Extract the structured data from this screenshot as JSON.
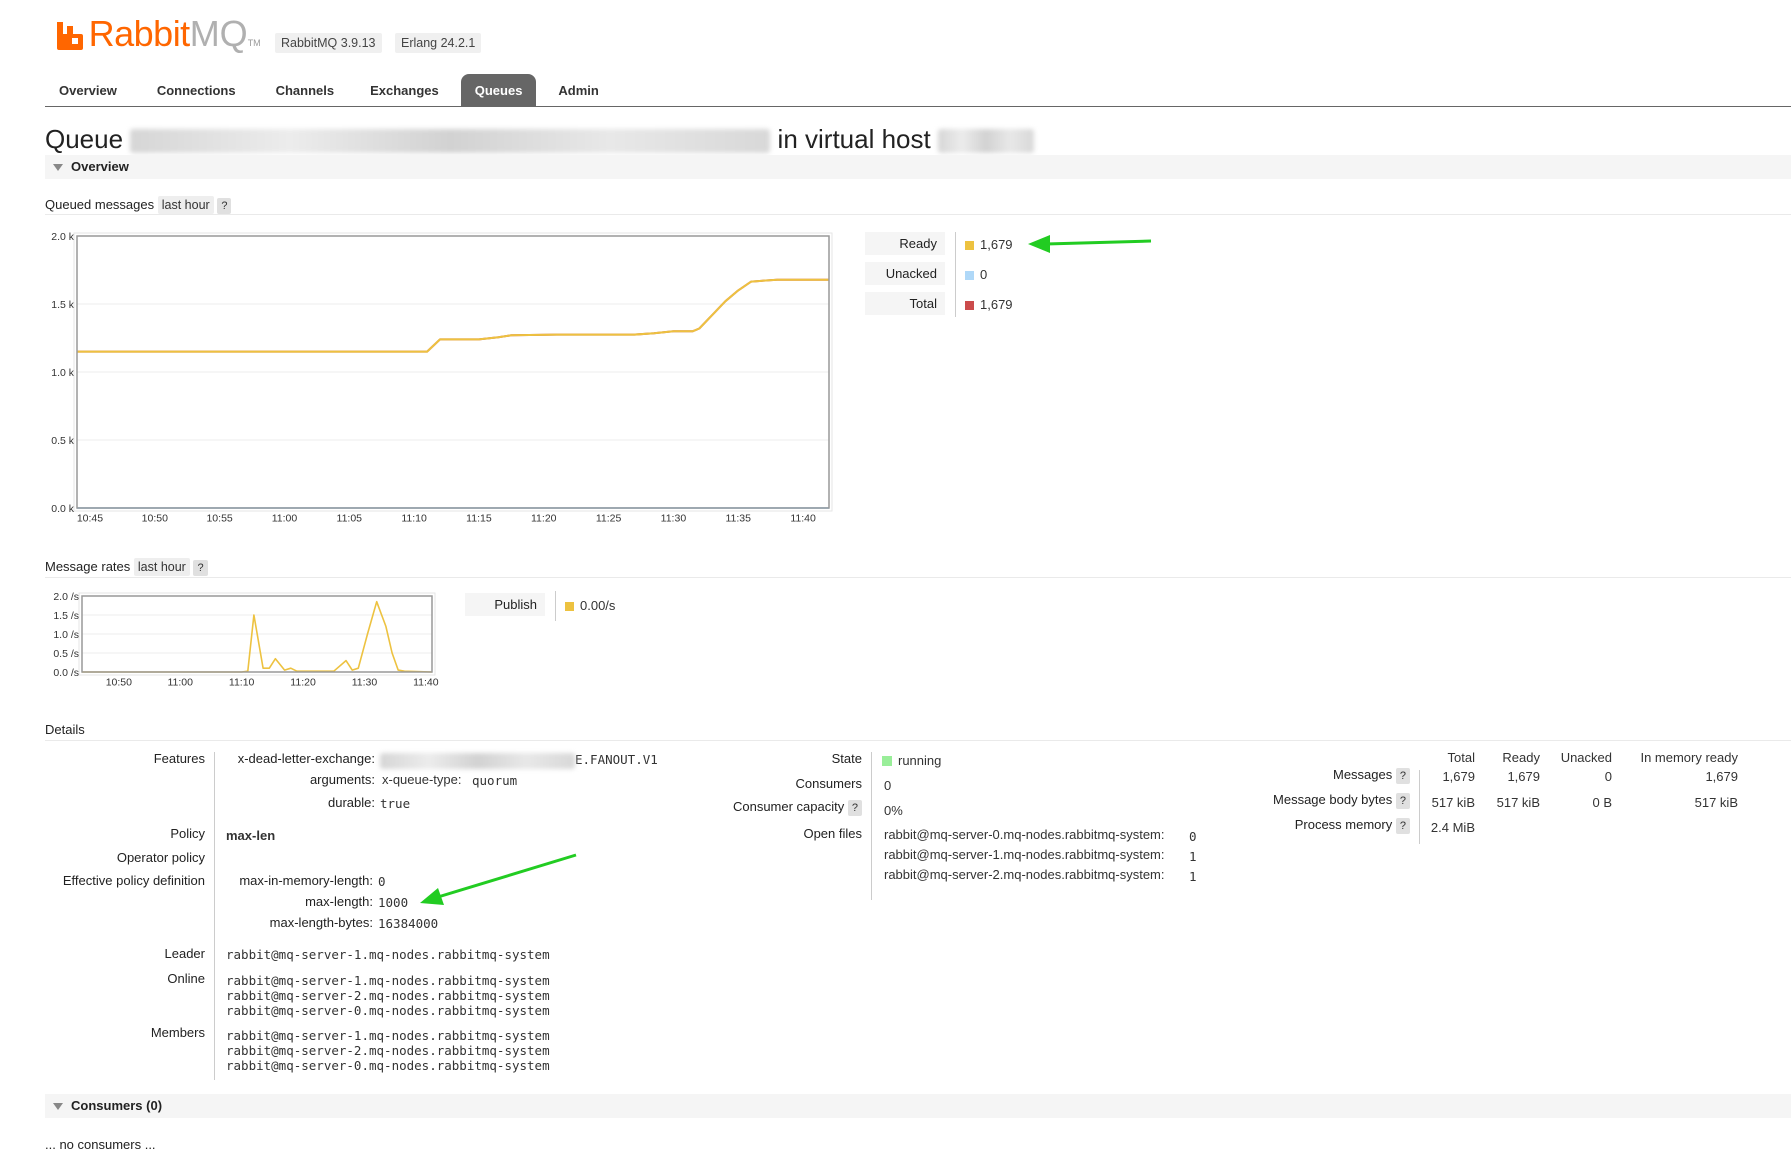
{
  "header": {
    "logo_rabbit": "Rabbit",
    "logo_mq": "MQ",
    "logo_tm": "TM",
    "rabbitmq_version": "RabbitMQ 3.9.13",
    "erlang_version": "Erlang 24.2.1"
  },
  "nav": {
    "tabs": [
      "Overview",
      "Connections",
      "Channels",
      "Exchanges",
      "Queues",
      "Admin"
    ],
    "active": "Queues"
  },
  "page": {
    "title_prefix": "Queue",
    "title_mid": "in virtual host"
  },
  "sections": {
    "overview": "Overview",
    "consumers": "Consumers (0)",
    "no_consumers": "... no consumers ..."
  },
  "queued_messages": {
    "label": "Queued messages",
    "range": "last hour",
    "help": "?",
    "legend": [
      {
        "label": "Ready",
        "value": "1,679",
        "color": "#edc240"
      },
      {
        "label": "Unacked",
        "value": "0",
        "color": "#afd8f8"
      },
      {
        "label": "Total",
        "value": "1,679",
        "color": "#cb4b4b"
      }
    ]
  },
  "message_rates": {
    "label": "Message rates",
    "range": "last hour",
    "help": "?",
    "legend": [
      {
        "label": "Publish",
        "value": "0.00/s",
        "color": "#edc240"
      }
    ]
  },
  "chart_data": [
    {
      "type": "line",
      "title": "Queued messages",
      "x_ticks": [
        "10:45",
        "10:50",
        "10:55",
        "11:00",
        "11:05",
        "11:10",
        "11:15",
        "11:20",
        "11:25",
        "11:30",
        "11:35",
        "11:40"
      ],
      "y_ticks": [
        "0.0 k",
        "0.5 k",
        "1.0 k",
        "1.5 k",
        "2.0 k"
      ],
      "xlim": [
        44.0,
        102.0
      ],
      "ylim": [
        0,
        2000
      ],
      "grid": true,
      "series": [
        {
          "name": "Total",
          "color": "#cb4b4b",
          "x": [
            44.0,
            71.0,
            72.0,
            75.0,
            76.5,
            77.5,
            81.0,
            87.0,
            88.5,
            90.0,
            91.5,
            92.0,
            93.0,
            94.0,
            95.0,
            96.0,
            98.0,
            102.0
          ],
          "y": [
            1150,
            1150,
            1240,
            1240,
            1255,
            1270,
            1275,
            1275,
            1285,
            1300,
            1300,
            1320,
            1420,
            1520,
            1600,
            1665,
            1679,
            1679
          ]
        },
        {
          "name": "Ready",
          "color": "#edc240",
          "x": [
            44.0,
            71.0,
            72.0,
            75.0,
            76.5,
            77.5,
            81.0,
            87.0,
            88.5,
            90.0,
            91.5,
            92.0,
            93.0,
            94.0,
            95.0,
            96.0,
            98.0,
            102.0
          ],
          "y": [
            1150,
            1150,
            1240,
            1240,
            1255,
            1270,
            1275,
            1275,
            1285,
            1300,
            1300,
            1320,
            1420,
            1520,
            1600,
            1665,
            1679,
            1679
          ]
        },
        {
          "name": "Unacked",
          "color": "#afd8f8",
          "x": [
            44.0,
            102.0
          ],
          "y": [
            0,
            0
          ]
        }
      ]
    },
    {
      "type": "line",
      "title": "Message rates",
      "x_ticks": [
        "10:50",
        "11:00",
        "11:10",
        "11:20",
        "11:30",
        "11:40"
      ],
      "y_ticks": [
        "0.0 /s",
        "0.5 /s",
        "1.0 /s",
        "1.5 /s",
        "2.0 /s"
      ],
      "xlim": [
        44.0,
        101.0
      ],
      "ylim": [
        0,
        2.0
      ],
      "grid": true,
      "series": [
        {
          "name": "Publish",
          "color": "#edc240",
          "x": [
            44.0,
            70.0,
            71.0,
            72.0,
            73.5,
            74.5,
            75.5,
            77.0,
            78.0,
            79.0,
            85.0,
            87.0,
            88.0,
            89.0,
            90.5,
            92.0,
            93.5,
            94.5,
            95.5,
            96.5,
            101.0
          ],
          "y": [
            0,
            0,
            0.02,
            1.5,
            0.1,
            0.1,
            0.35,
            0.05,
            0.1,
            0.02,
            0.02,
            0.3,
            0.05,
            0.1,
            1.0,
            1.85,
            1.2,
            0.5,
            0.05,
            0.02,
            0
          ]
        }
      ]
    }
  ],
  "details": {
    "label": "Details",
    "features": {
      "key": "Features",
      "dle_key": "x-dead-letter-exchange:",
      "dle_value_suffix": "E.FANOUT.V1",
      "arguments_key": "arguments:",
      "queue_type_key": "x-queue-type:",
      "queue_type_value": "quorum",
      "durable_key": "durable:",
      "durable_value": "true"
    },
    "policy": {
      "key": "Policy",
      "value": "max-len"
    },
    "operator_policy": {
      "key": "Operator policy",
      "value": ""
    },
    "effective_policy": {
      "key": "Effective policy definition",
      "items": [
        {
          "key": "max-in-memory-length:",
          "value": "0"
        },
        {
          "key": "max-length:",
          "value": "1000"
        },
        {
          "key": "max-length-bytes:",
          "value": "16384000"
        }
      ]
    },
    "leader": {
      "key": "Leader",
      "value": "rabbit@mq-server-1.mq-nodes.rabbitmq-system"
    },
    "online": {
      "key": "Online",
      "values": [
        "rabbit@mq-server-1.mq-nodes.rabbitmq-system",
        "rabbit@mq-server-2.mq-nodes.rabbitmq-system",
        "rabbit@mq-server-0.mq-nodes.rabbitmq-system"
      ]
    },
    "members": {
      "key": "Members",
      "values": [
        "rabbit@mq-server-1.mq-nodes.rabbitmq-system",
        "rabbit@mq-server-2.mq-nodes.rabbitmq-system",
        "rabbit@mq-server-0.mq-nodes.rabbitmq-system"
      ]
    },
    "state": {
      "key": "State",
      "value": "running",
      "color": "#99ee99"
    },
    "consumers": {
      "key": "Consumers",
      "value": "0"
    },
    "consumer_capacity": {
      "key": "Consumer capacity",
      "help": "?",
      "value": "0%"
    },
    "open_files": {
      "key": "Open files",
      "items": [
        {
          "node": "rabbit@mq-server-0.mq-nodes.rabbitmq-system:",
          "value": "0"
        },
        {
          "node": "rabbit@mq-server-1.mq-nodes.rabbitmq-system:",
          "value": "1"
        },
        {
          "node": "rabbit@mq-server-2.mq-nodes.rabbitmq-system:",
          "value": "1"
        }
      ]
    },
    "stats": {
      "columns": [
        "Total",
        "Ready",
        "Unacked",
        "In memory ready"
      ],
      "rows": [
        {
          "label": "Messages",
          "help": "?",
          "values": [
            "1,679",
            "1,679",
            "0",
            "1,679"
          ]
        },
        {
          "label": "Message body bytes",
          "help": "?",
          "values": [
            "517 kiB",
            "517 kiB",
            "0 B",
            "517 kiB"
          ]
        },
        {
          "label": "Process memory",
          "help": "?",
          "values": [
            "2.4 MiB",
            "",
            "",
            ""
          ]
        }
      ]
    }
  }
}
